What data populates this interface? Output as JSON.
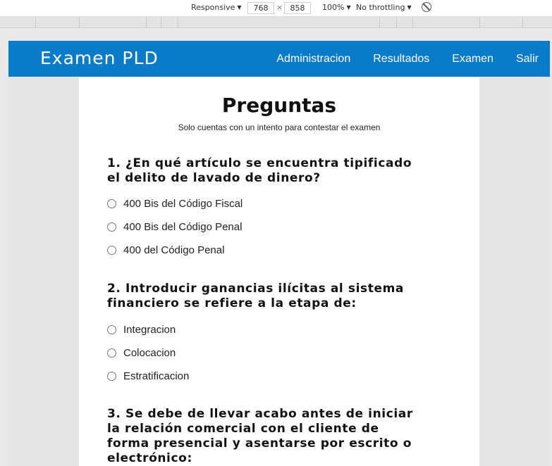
{
  "devtools": {
    "device": "Responsive",
    "width": "768",
    "height": "858",
    "zoom": "100%",
    "throttling": "No throttling"
  },
  "navbar": {
    "brand": "Examen PLD",
    "links": [
      "Administracion",
      "Resultados",
      "Examen",
      "Salir"
    ]
  },
  "page": {
    "title": "Preguntas",
    "subtitle": "Solo cuentas con un intento para contestar el examen"
  },
  "questions": [
    {
      "text": "1. ¿En qué artículo se encuentra tipificado el delito de lavado de dinero?",
      "options": [
        "400 Bis del Código Fiscal",
        "400 Bis del Código Penal",
        "400 del Código Penal"
      ]
    },
    {
      "text": "2. Introducir ganancias ilícitas al sistema financiero se refiere a la etapa de:",
      "options": [
        "Integracion",
        "Colocacion",
        "Estratificacion"
      ]
    },
    {
      "text": "3. Se debe de llevar acabo antes de iniciar la relación comercial con el cliente de forma presencial y asentarse por escrito o electrónico:",
      "options": []
    }
  ]
}
